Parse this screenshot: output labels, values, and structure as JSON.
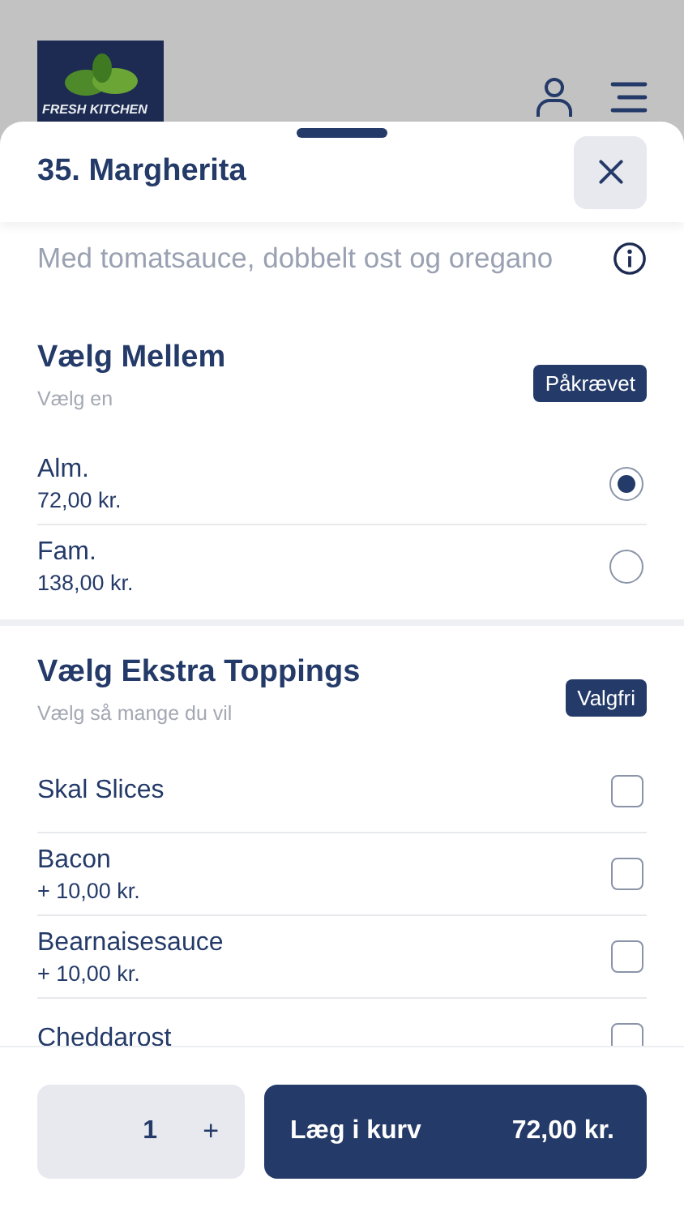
{
  "header": {
    "logo_text": "FRESH KITCHEN"
  },
  "sheet": {
    "title": "35. Margherita",
    "description": "Med tomatsauce, dobbelt ost og oregano"
  },
  "groups": [
    {
      "title": "Vælg Mellem",
      "subtitle": "Vælg en",
      "badge": "Påkrævet",
      "kind": "radio",
      "options": [
        {
          "name": "Alm.",
          "price": "72,00 kr.",
          "selected": true
        },
        {
          "name": "Fam.",
          "price": "138,00 kr.",
          "selected": false
        }
      ]
    },
    {
      "title": "Vælg Ekstra Toppings",
      "subtitle": "Vælg så mange du vil",
      "badge": "Valgfri",
      "kind": "checkbox",
      "options": [
        {
          "name": "Skal Slices",
          "checked": false
        },
        {
          "name": "Bacon",
          "price": "+ 10,00 kr.",
          "checked": false
        },
        {
          "name": "Bearnaisesauce",
          "price": "+ 10,00 kr.",
          "checked": false
        },
        {
          "name": "Cheddarost",
          "checked": false
        }
      ]
    }
  ],
  "footer": {
    "quantity": "1",
    "plus": "+",
    "add_label": "Læg i kurv",
    "total": "72,00 kr."
  }
}
